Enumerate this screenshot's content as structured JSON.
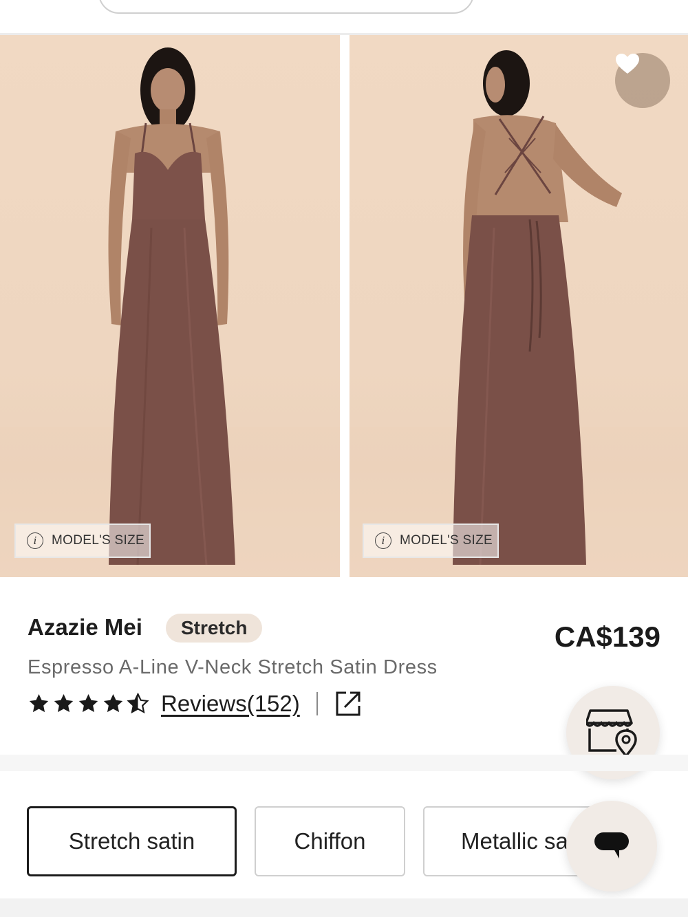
{
  "gallery": {
    "images": [
      {
        "alt": "dress-front",
        "model_size_label": "MODEL'S SIZE"
      },
      {
        "alt": "dress-back",
        "model_size_label": "MODEL'S SIZE"
      }
    ]
  },
  "product": {
    "brand": "Azazie Mei",
    "badge": "Stretch",
    "name": "Espresso A-Line V-Neck Stretch Satin Dress",
    "price": "CA$139",
    "rating": 4.5,
    "reviews_label": "Reviews(152)"
  },
  "fabrics": [
    {
      "label": "Stretch satin",
      "selected": true
    },
    {
      "label": "Chiffon",
      "selected": false
    },
    {
      "label": "Metallic sa",
      "selected": false
    }
  ],
  "icons": {
    "favorite": "heart-icon",
    "info": "info-icon",
    "share": "share-icon",
    "store": "store-location-icon",
    "chat": "chat-icon"
  },
  "colors": {
    "dress": "#7a5048",
    "backdrop": "#efd7c1",
    "badge_bg": "#efe4da",
    "floating_btn_bg": "#f1ebe6"
  }
}
